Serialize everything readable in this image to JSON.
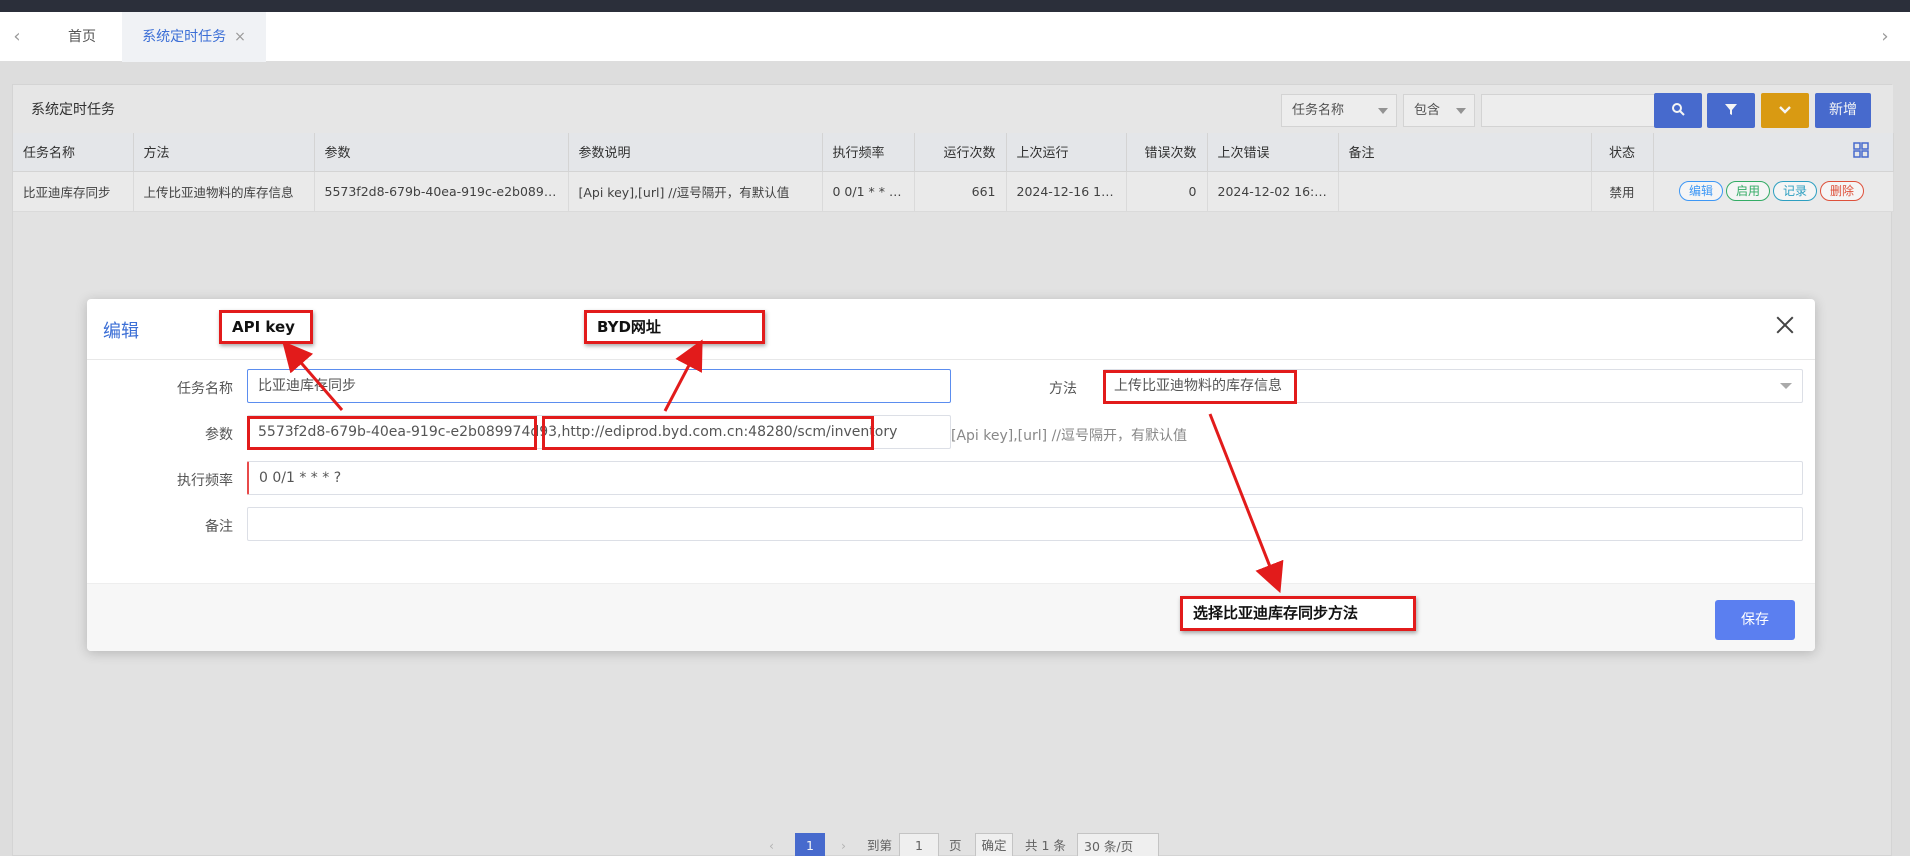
{
  "tabs": {
    "prev_icon": "‹",
    "next_icon": "›",
    "items": [
      {
        "label": "首页"
      },
      {
        "label": "系统定时任务",
        "close": "×"
      }
    ]
  },
  "toolbar": {
    "title": "系统定时任务",
    "field_select": "任务名称",
    "op_select": "包含",
    "search_value": "",
    "add_label": "新增"
  },
  "table": {
    "columns": [
      "任务名称",
      "方法",
      "参数",
      "参数说明",
      "执行频率",
      "运行次数",
      "上次运行",
      "错误次数",
      "上次错误",
      "备注",
      "状态"
    ],
    "row": {
      "name": "比亚迪库存同步",
      "method": "上传比亚迪物料的库存信息",
      "params": "5573f2d8-679b-40ea-919c-e2b089974...",
      "param_desc": "[Api key],[url] //逗号隔开，有默认值",
      "cron": "0 0/1 * * * ?",
      "run_count": "661",
      "last_run": "2024-12-16 12:2...",
      "error_count": "0",
      "last_error": "2024-12-02 16:4...",
      "remark": "",
      "status": "禁用",
      "actions": [
        "编辑",
        "启用",
        "记录",
        "删除"
      ]
    }
  },
  "pager": {
    "current": "1",
    "goto_label": "到第",
    "goto_value": "1",
    "page_unit": "页",
    "confirm": "确定",
    "total": "共 1 条",
    "page_size": "30 条/页"
  },
  "modal": {
    "title": "编辑",
    "fields": {
      "name_label": "任务名称",
      "name_value": "比亚迪库存同步",
      "method_label": "方法",
      "method_value": "上传比亚迪物料的库存信息",
      "params_label": "参数",
      "params_value": "5573f2d8-679b-40ea-919c-e2b089974d93,http://ediprod.byd.com.cn:48280/scm/inventory",
      "params_hint": "[Api key],[url] //逗号隔开，有默认值",
      "cron_label": "执行频率",
      "cron_value": "0 0/1 * * * ?",
      "remark_label": "备注",
      "remark_value": ""
    },
    "save_label": "保存"
  },
  "annotations": {
    "api_key": "API key",
    "byd_url": "BYD网址",
    "method": "选择比亚迪库存同步方法"
  },
  "colors": {
    "accent": "#4a6fd6",
    "annotation_red": "#e21b1b",
    "orange": "#e2a113"
  }
}
